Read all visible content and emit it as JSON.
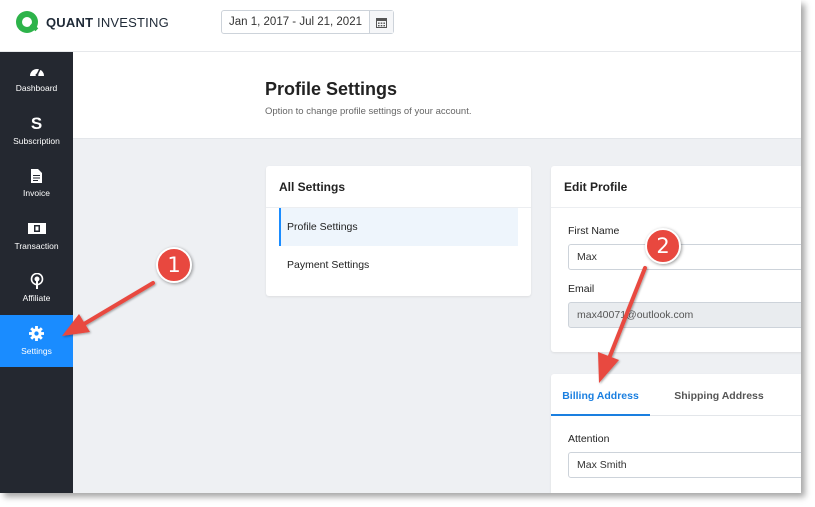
{
  "brand": {
    "name_bold": "QUANT",
    "name_rest": " INVESTING",
    "color": "#2db34a"
  },
  "header": {
    "date_range": "Jan 1, 2017 - Jul 21, 2021",
    "calendar_icon": "calendar-icon"
  },
  "sidebar": {
    "items": [
      {
        "label": "Dashboard",
        "icon": "gauge-icon"
      },
      {
        "label": "Subscription",
        "icon": "dollar-icon"
      },
      {
        "label": "Invoice",
        "icon": "document-icon"
      },
      {
        "label": "Transaction",
        "icon": "banknote-icon"
      },
      {
        "label": "Affiliate",
        "icon": "broadcast-icon"
      },
      {
        "label": "Settings",
        "icon": "gear-icon",
        "active": true
      }
    ]
  },
  "page": {
    "title": "Profile Settings",
    "subtitle": "Option to change profile settings of your account."
  },
  "all_settings": {
    "title": "All Settings",
    "items": [
      "Profile Settings",
      "Payment Settings"
    ],
    "active_item": "Profile Settings"
  },
  "edit_profile": {
    "title": "Edit Profile",
    "first_name_label": "First Name",
    "first_name_value": "Max",
    "email_label": "Email",
    "email_value": "max40071@outlook.com"
  },
  "address": {
    "tabs": [
      "Billing Address",
      "Shipping Address"
    ],
    "active_tab": "Billing Address",
    "attention_label": "Attention",
    "attention_value": "Max Smith"
  },
  "annotations": [
    {
      "number": "1"
    },
    {
      "number": "2"
    }
  ],
  "colors": {
    "accent": "#1a8cff",
    "sidebar_bg": "#242830",
    "annotation_red": "#e8483f"
  }
}
